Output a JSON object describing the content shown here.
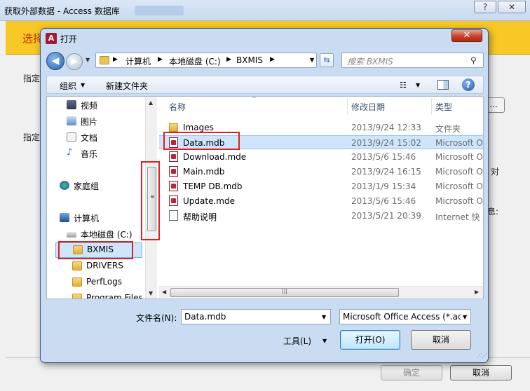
{
  "background_window": {
    "title": "获取外部数据 - Access 数据库",
    "help_label": "?",
    "close_label": "✕",
    "banner_text": "选择",
    "label_top": "指定",
    "label_mid": "指定",
    "browse_label": "...",
    "side_text_1": "对",
    "side_text_2": "息:",
    "ok_label": "确定",
    "cancel_label": "取消"
  },
  "dialog": {
    "title": "打开",
    "close_label": "✕",
    "address": {
      "crumbs": [
        "计算机",
        "本地磁盘 (C:)",
        "BXMIS"
      ]
    },
    "search_placeholder": "搜索 BXMIS",
    "toolbar": {
      "organize_label": "组织",
      "new_folder_label": "新建文件夹"
    },
    "nav_items": [
      {
        "label": "视频",
        "icon": "video-icon"
      },
      {
        "label": "图片",
        "icon": "pictures-icon"
      },
      {
        "label": "文档",
        "icon": "documents-icon"
      },
      {
        "label": "音乐",
        "icon": "music-icon"
      },
      {
        "label": "家庭组",
        "icon": "homegroup-icon"
      },
      {
        "label": "计算机",
        "icon": "computer-icon"
      },
      {
        "label": "本地磁盘 (C:)",
        "icon": "disk-icon"
      },
      {
        "label": "BXMIS",
        "icon": "folder-icon",
        "selected": true
      },
      {
        "label": "DRIVERS",
        "icon": "folder-icon"
      },
      {
        "label": "PerfLogs",
        "icon": "folder-icon"
      },
      {
        "label": "Program Files",
        "icon": "folder-icon"
      }
    ],
    "columns": {
      "name": "名称",
      "date": "修改日期",
      "type": "类型"
    },
    "files": [
      {
        "name": "Images",
        "date": "2013/9/24 12:33",
        "type": "文件夹",
        "icon": "folder-icon"
      },
      {
        "name": "Data.mdb",
        "date": "2013/9/24 15:02",
        "type": "Microsoft O",
        "icon": "access-file-icon",
        "selected": true
      },
      {
        "name": "Download.mde",
        "date": "2013/5/6 15:46",
        "type": "Microsoft O",
        "icon": "access-file-icon"
      },
      {
        "name": "Main.mdb",
        "date": "2013/9/24 16:15",
        "type": "Microsoft O",
        "icon": "access-file-icon"
      },
      {
        "name": "TEMP DB.mdb",
        "date": "2013/1/9 15:34",
        "type": "Microsoft O",
        "icon": "access-file-icon"
      },
      {
        "name": "Update.mde",
        "date": "2013/5/6 15:46",
        "type": "Microsoft O",
        "icon": "access-file-icon"
      },
      {
        "name": "帮助说明",
        "date": "2013/5/21 20:39",
        "type": "Internet 快",
        "icon": "shortcut-icon"
      }
    ],
    "filename_label": "文件名(N):",
    "filename_value": "Data.mdb",
    "filetype_value": "Microsoft Office Access (*.ac",
    "tools_label": "工具(L)",
    "open_label": "打开(O)",
    "cancel_label": "取消"
  },
  "colors": {
    "banner": "#f8c826",
    "highlight": "#e02020",
    "selection": "#cde6fb"
  }
}
